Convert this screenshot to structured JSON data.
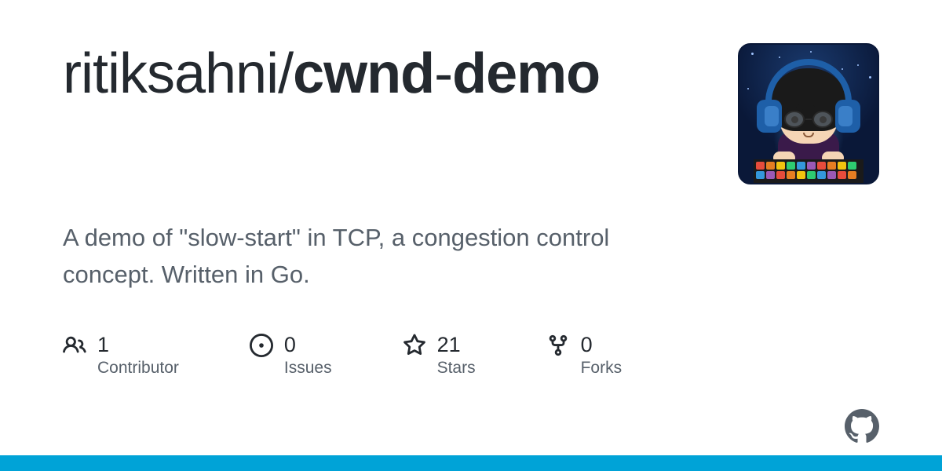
{
  "repo": {
    "owner": "ritiksahni",
    "separator": "/",
    "name": "cwnd",
    "hyphen": "-",
    "suffix": "demo"
  },
  "description": "A demo of \"slow-start\" in TCP, a congestion control concept. Written in Go.",
  "stats": {
    "contributors": {
      "count": "1",
      "label": "Contributor"
    },
    "issues": {
      "count": "0",
      "label": "Issues"
    },
    "stars": {
      "count": "21",
      "label": "Stars"
    },
    "forks": {
      "count": "0",
      "label": "Forks"
    }
  },
  "colors": {
    "accent_bar": "#00a3d7",
    "text_primary": "#24292f",
    "text_secondary": "#57606a"
  }
}
